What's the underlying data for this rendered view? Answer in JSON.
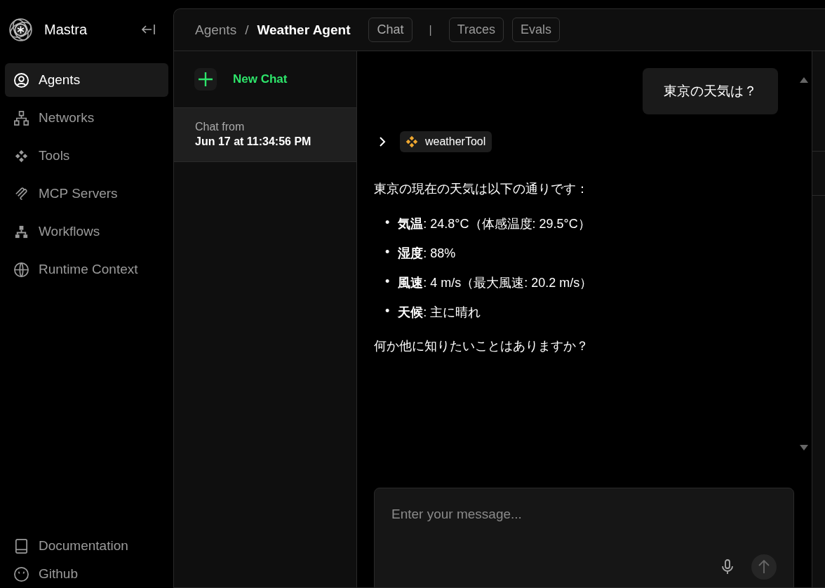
{
  "brand": {
    "name": "Mastra"
  },
  "sidebar": {
    "items": [
      {
        "label": "Agents",
        "selected": true
      },
      {
        "label": "Networks",
        "selected": false
      },
      {
        "label": "Tools",
        "selected": false
      },
      {
        "label": "MCP Servers",
        "selected": false
      },
      {
        "label": "Workflows",
        "selected": false
      },
      {
        "label": "Runtime Context",
        "selected": false
      }
    ],
    "footer": [
      {
        "label": "Documentation"
      },
      {
        "label": "Github"
      }
    ]
  },
  "breadcrumb": [
    "Agents",
    "Weather Agent"
  ],
  "breadcrumb_separator": "/",
  "tabs": [
    {
      "label": "Chat",
      "selected": true
    },
    {
      "label": "Traces",
      "selected": false
    },
    {
      "label": "Evals",
      "selected": false
    }
  ],
  "tab_separator": "|",
  "new_chat": "New Chat",
  "threads": [
    {
      "line1": "Chat from",
      "line2": "Jun 17 at 11:34:56 PM",
      "selected": true
    }
  ],
  "messages": [
    {
      "kind": "user",
      "text": "東京の天気は？"
    },
    {
      "kind": "tool",
      "name": "weatherTool"
    },
    {
      "kind": "assistant",
      "intro": "東京の現在の天気は以下の通りです：",
      "bullet": "•",
      "bullets": [
        "**気温**: 24.8°C（体感温度: 29.5°C）",
        "**湿度**: 88%",
        "**風速**: 4 m/s（最大風速: 20.2 m/s）",
        "**天候**: 主に晴れ"
      ],
      "outro": "何か他に知りたいことはありますか？"
    }
  ],
  "composer": {
    "placeholder": "Enter your message..."
  }
}
